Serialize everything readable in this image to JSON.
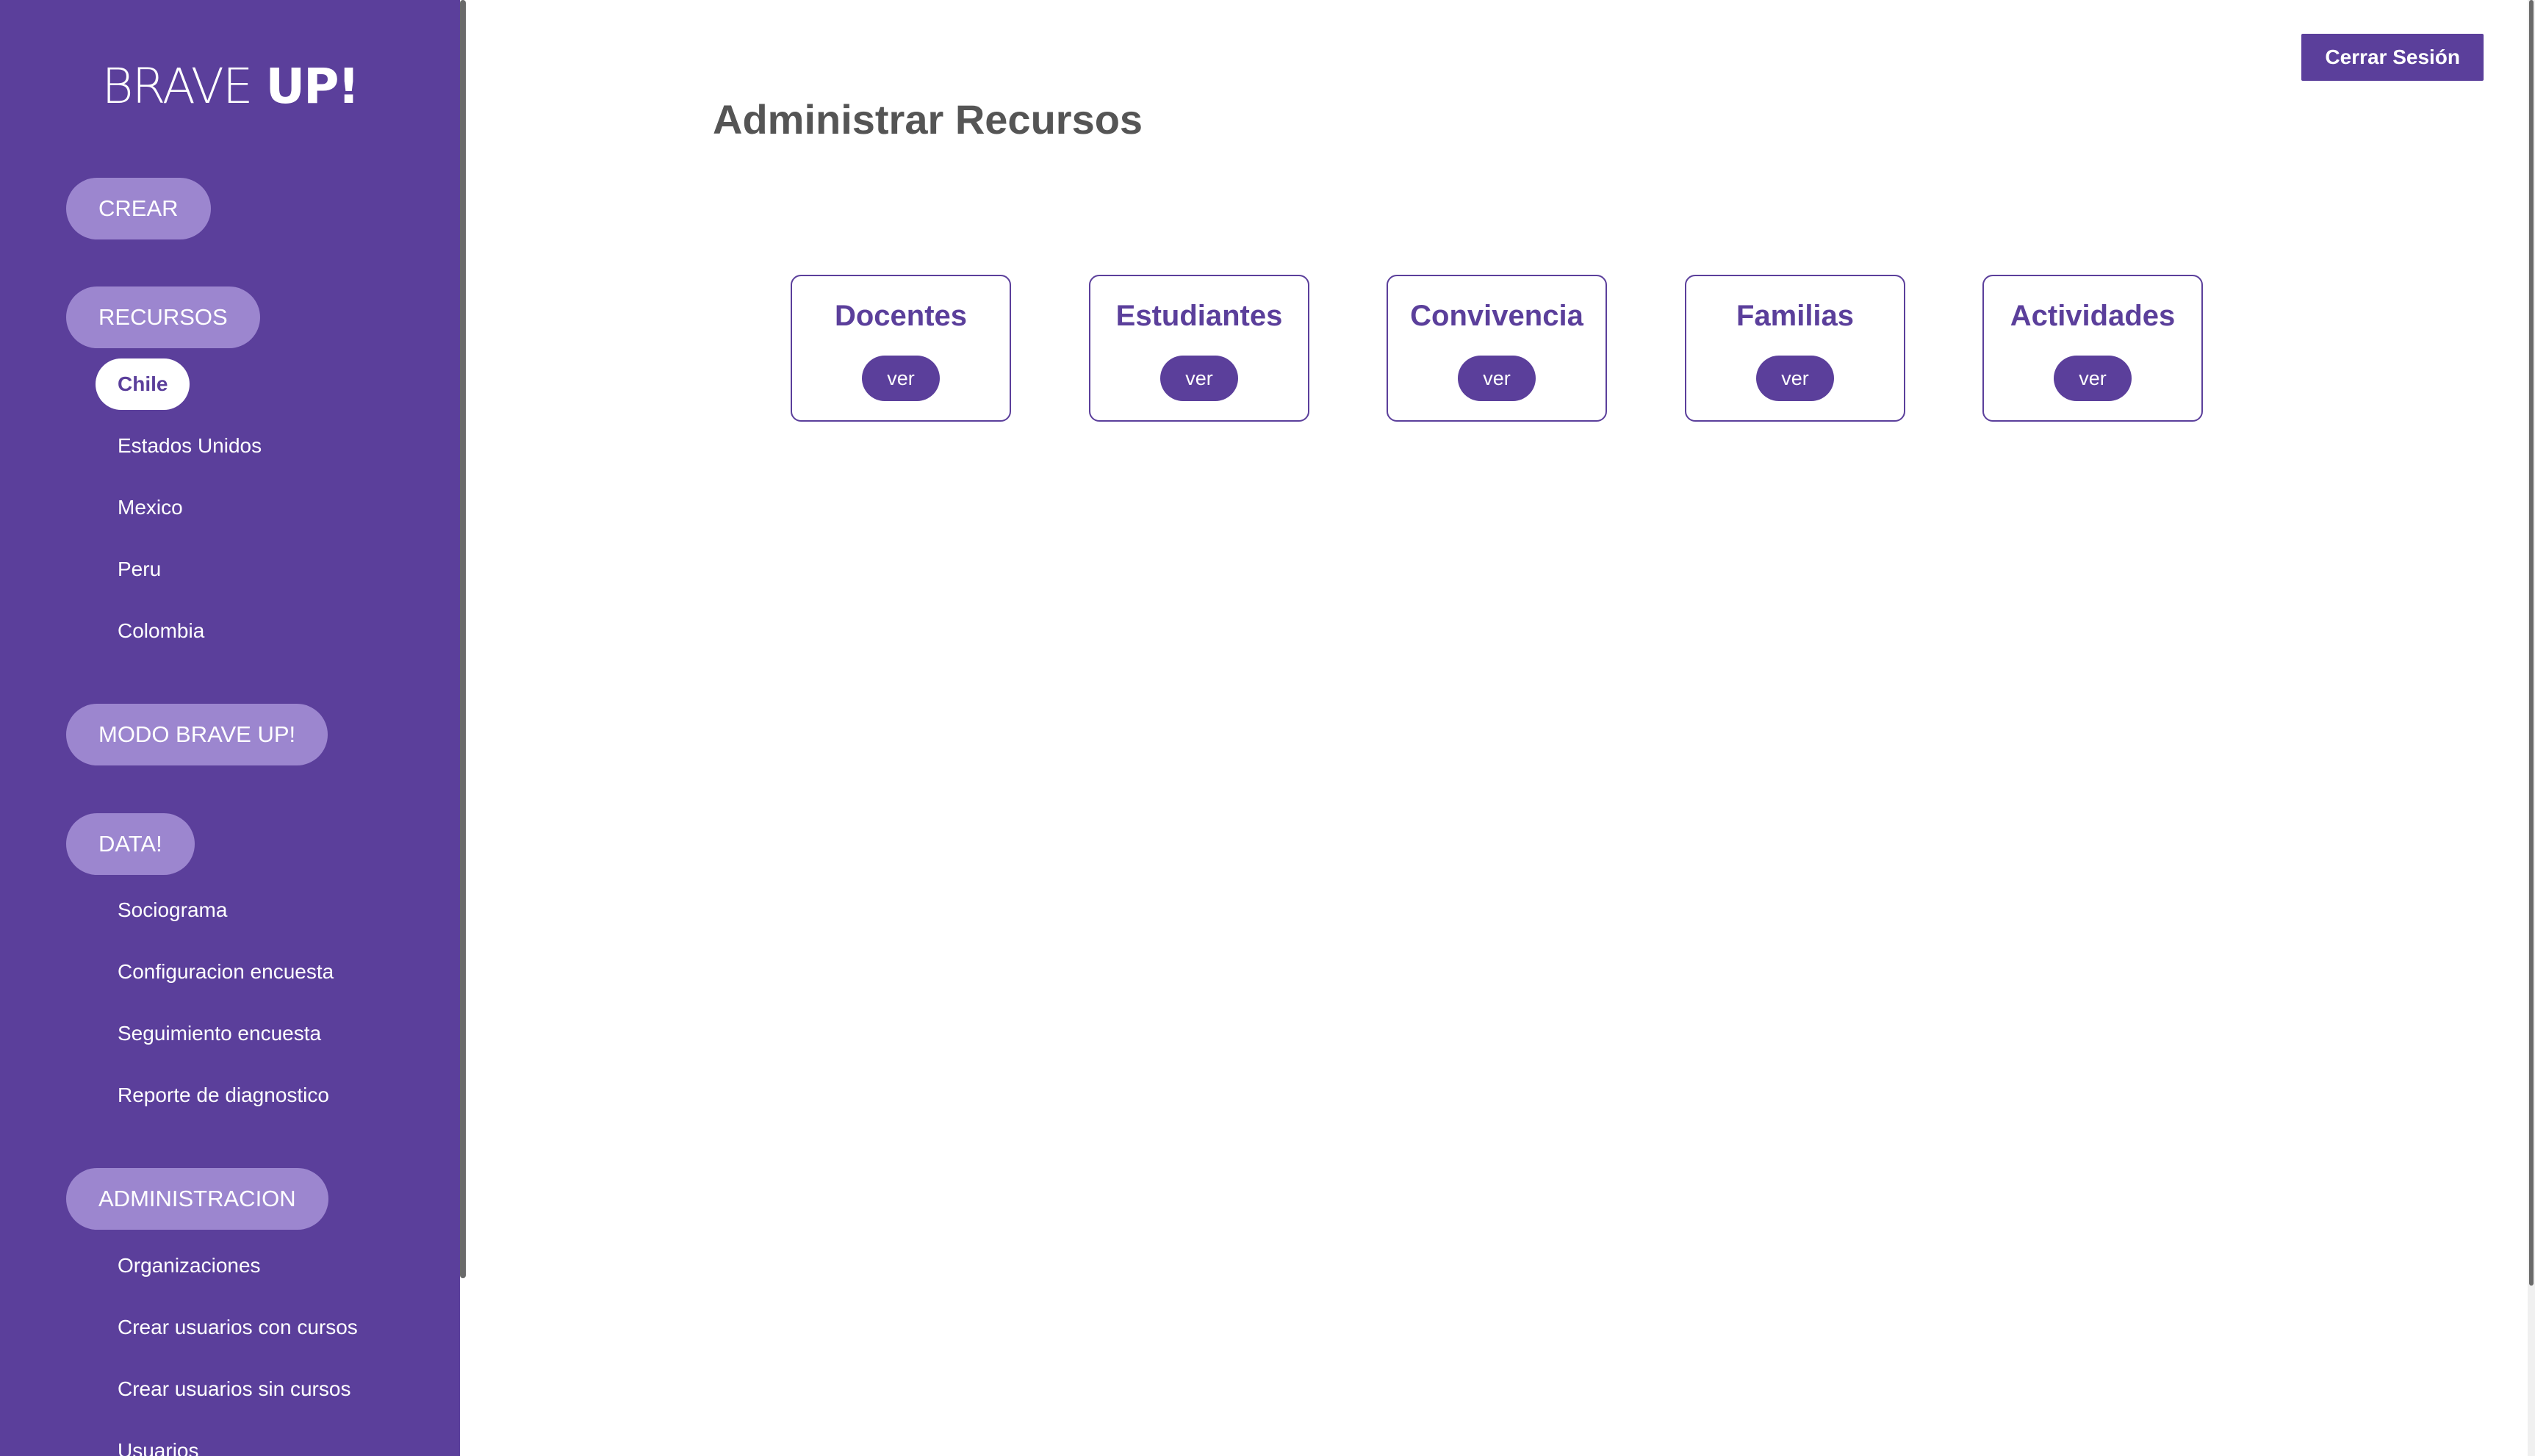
{
  "sidebar": {
    "logo_light": "BRAVE ",
    "logo_bold": "UP!",
    "sections": {
      "crear": "CREAR",
      "recursos": "RECURSOS",
      "modo": "MODO BRAVE UP!",
      "data": "DATA!",
      "administracion": "ADMINISTRACION"
    },
    "recursos_items": [
      "Chile",
      "Estados Unidos",
      "Mexico",
      "Peru",
      "Colombia"
    ],
    "data_items": [
      "Sociograma",
      "Configuracion encuesta",
      "Seguimiento encuesta",
      "Reporte de diagnostico"
    ],
    "admin_items": [
      "Organizaciones",
      "Crear usuarios con cursos",
      "Crear usuarios sin cursos",
      "Usuarios"
    ]
  },
  "header": {
    "logout_label": "Cerrar Sesión"
  },
  "main": {
    "title": "Administrar Recursos",
    "cards": [
      {
        "title": "Docentes",
        "button": "ver"
      },
      {
        "title": "Estudiantes",
        "button": "ver"
      },
      {
        "title": "Convivencia",
        "button": "ver"
      },
      {
        "title": "Familias",
        "button": "ver"
      },
      {
        "title": "Actividades",
        "button": "ver"
      }
    ]
  },
  "colors": {
    "sidebar_bg": "#5b3f9b",
    "pill_bg": "#9c86cf",
    "accent": "#5b3f9b",
    "title_text": "#555555"
  }
}
